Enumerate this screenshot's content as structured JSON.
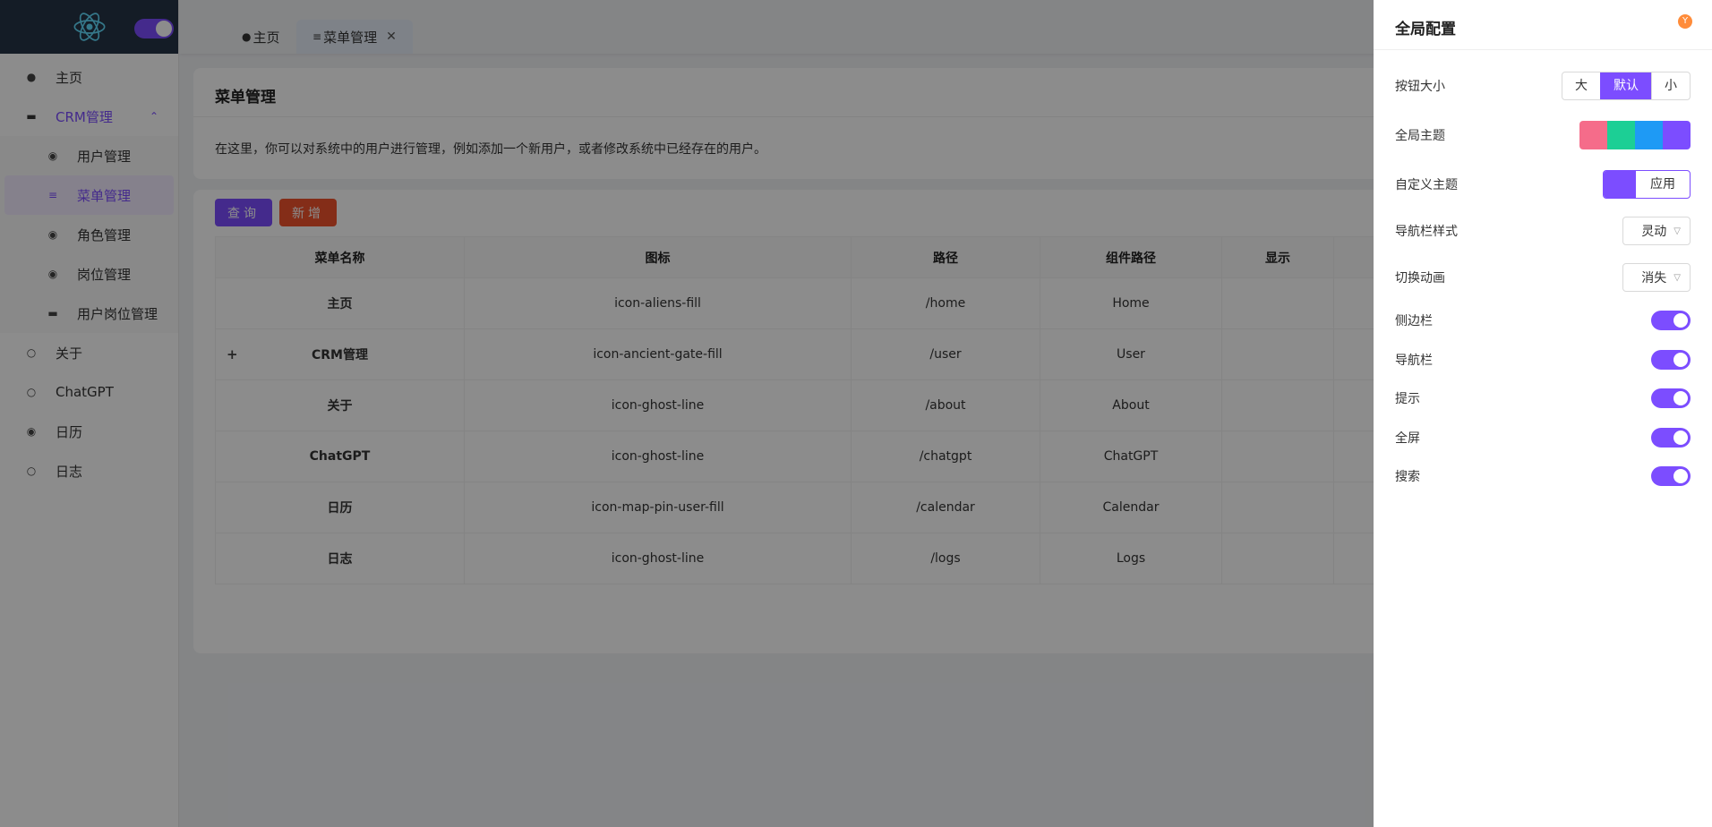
{
  "sidebar": {
    "items": [
      {
        "label": "主页",
        "icon": "alien-icon"
      },
      {
        "label": "CRM管理",
        "icon": "gate-icon",
        "open": true
      },
      {
        "label": "关于",
        "icon": "ghost-icon"
      },
      {
        "label": "ChatGPT",
        "icon": "ghost-icon"
      },
      {
        "label": "日历",
        "icon": "map-pin-user-icon"
      },
      {
        "label": "日志",
        "icon": "ghost-icon"
      }
    ],
    "subitems": [
      {
        "label": "用户管理",
        "icon": "map-pin-user-icon"
      },
      {
        "label": "菜单管理",
        "icon": "menu-icon",
        "active": true
      },
      {
        "label": "角色管理",
        "icon": "map-pin-user-icon"
      },
      {
        "label": "岗位管理",
        "icon": "map-pin-user-icon"
      },
      {
        "label": "用户岗位管理",
        "icon": "gate-icon"
      }
    ]
  },
  "tabs": [
    {
      "label": "主页"
    },
    {
      "label": "菜单管理"
    }
  ],
  "page": {
    "title": "菜单管理",
    "description": "在这里，你可以对系统中的用户进行管理，例如添加一个新用户，或者修改系统中已经存在的用户。",
    "query_label": "查询",
    "add_label": "新增"
  },
  "table": {
    "columns": [
      "菜单名称",
      "图标",
      "路径",
      "组件路径",
      "显示"
    ],
    "rows": [
      {
        "name": "主页",
        "icon": "icon-aliens-fill",
        "path": "/home",
        "component": "Home",
        "expandable": false
      },
      {
        "name": "CRM管理",
        "icon": "icon-ancient-gate-fill",
        "path": "/user",
        "component": "User",
        "expandable": true
      },
      {
        "name": "关于",
        "icon": "icon-ghost-line",
        "path": "/about",
        "component": "About",
        "expandable": false
      },
      {
        "name": "ChatGPT",
        "icon": "icon-ghost-line",
        "path": "/chatgpt",
        "component": "ChatGPT",
        "expandable": false
      },
      {
        "name": "日历",
        "icon": "icon-map-pin-user-fill",
        "path": "/calendar",
        "component": "Calendar",
        "expandable": false
      },
      {
        "name": "日志",
        "icon": "icon-ghost-line",
        "path": "/logs",
        "component": "Logs",
        "expandable": false
      }
    ],
    "expand_symbol": "+"
  },
  "drawer": {
    "title": "全局配置",
    "button_size": {
      "label": "按钮大小",
      "options": [
        "大",
        "默认",
        "小"
      ],
      "selected": "默认"
    },
    "global_theme": {
      "label": "全局主题",
      "colors": [
        "#f56c8a",
        "#1ccf95",
        "#1e9af5",
        "#7c4dff"
      ]
    },
    "custom_theme": {
      "label": "自定义主题",
      "apply_label": "应用",
      "color": "#7c4dff"
    },
    "nav_style": {
      "label": "导航栏样式",
      "value": "灵动"
    },
    "transition": {
      "label": "切换动画",
      "value": "消失"
    },
    "toggles": [
      {
        "label": "侧边栏",
        "on": true
      },
      {
        "label": "导航栏",
        "on": true
      },
      {
        "label": "提示",
        "on": true
      },
      {
        "label": "全屏",
        "on": true
      },
      {
        "label": "搜索",
        "on": true
      }
    ]
  },
  "colors": {
    "accent": "#7c4dff",
    "danger": "#f0532c",
    "sidebar_header": "#263346"
  }
}
